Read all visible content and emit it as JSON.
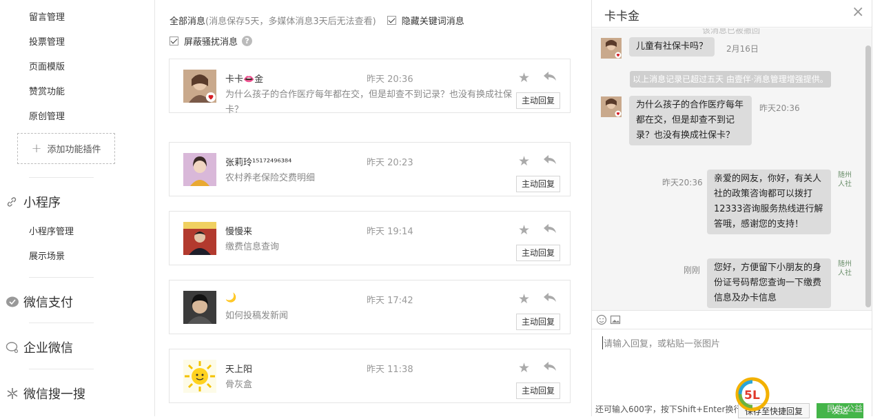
{
  "sidebar": {
    "items_top": [
      "留言管理",
      "投票管理",
      "页面模版",
      "赞赏功能",
      "原创管理"
    ],
    "add_plugin_label": "添加功能插件",
    "mini_program": {
      "title": "小程序",
      "items": [
        "小程序管理",
        "展示场景"
      ]
    },
    "sections": [
      "微信支付",
      "企业微信",
      "微信搜一搜"
    ]
  },
  "messages_panel": {
    "all_label": "全部消息",
    "all_hint": "(消息保存5天，多媒体消息3天后无法查看)",
    "hide_keyword_label": "隐藏关键词消息",
    "block_harass_label": "屏蔽骚扰消息",
    "help_icon": "?",
    "reply_button_label": "主动回复",
    "items": [
      {
        "name": "卡卡👄金",
        "time": "昨天 20:36",
        "text": "为什么孩子的合作医疗每年都在交，但是却查不到记录？也没有换成社保卡？"
      },
      {
        "name": "张莉玲¹⁵¹⁷²⁴⁹⁶³⁸⁴",
        "time": "昨天 20:23",
        "text": "农村养老保险交费明细"
      },
      {
        "name": "慢慢来",
        "time": "昨天 19:14",
        "text": "缴费信息查询"
      },
      {
        "name": "🌙",
        "time": "昨天 17:42",
        "text": "如何投稿发新闻"
      },
      {
        "name": "天上阳",
        "time": "昨天 11:38",
        "text": "骨灰盒"
      }
    ]
  },
  "chat": {
    "title": "卡卡金",
    "close_icon": "×",
    "faded_top": "该消息已被撤回",
    "msg1": {
      "text": "儿童有社保卡吗？",
      "time": "2月16日"
    },
    "system_notice": "以上消息记录已超过五天 由壹伴·消息管理增强提供。",
    "msg2": {
      "text": "为什么孩子的合作医疗每年都在交，但是却查不到记录？也没有换成社保卡？",
      "time": "昨天20:36"
    },
    "reply1": {
      "text": "亲爱的网友，你好，有关人社的政策咨询都可以拨打12333咨询服务热线进行解答哦，感谢您的支持！",
      "time": "昨天20:36",
      "sig": "随州人社"
    },
    "reply2": {
      "text": "您好，方便留下小朋友的身份证号码帮您查询一下缴费信息及办卡信息",
      "time": "刚刚",
      "sig": "随州人社"
    },
    "input_placeholder": "请输入回复，或粘贴一张图片",
    "remaining": "还可输入600字，按下Shift+Enter换行",
    "save_label": "保存至快捷回复",
    "send_label": "发送"
  },
  "watermark": {
    "text": "民生·公益"
  },
  "colors": {
    "accent": "#44b549",
    "bubble": "#dcdcdc",
    "chat_bg": "#f5f5f5"
  }
}
